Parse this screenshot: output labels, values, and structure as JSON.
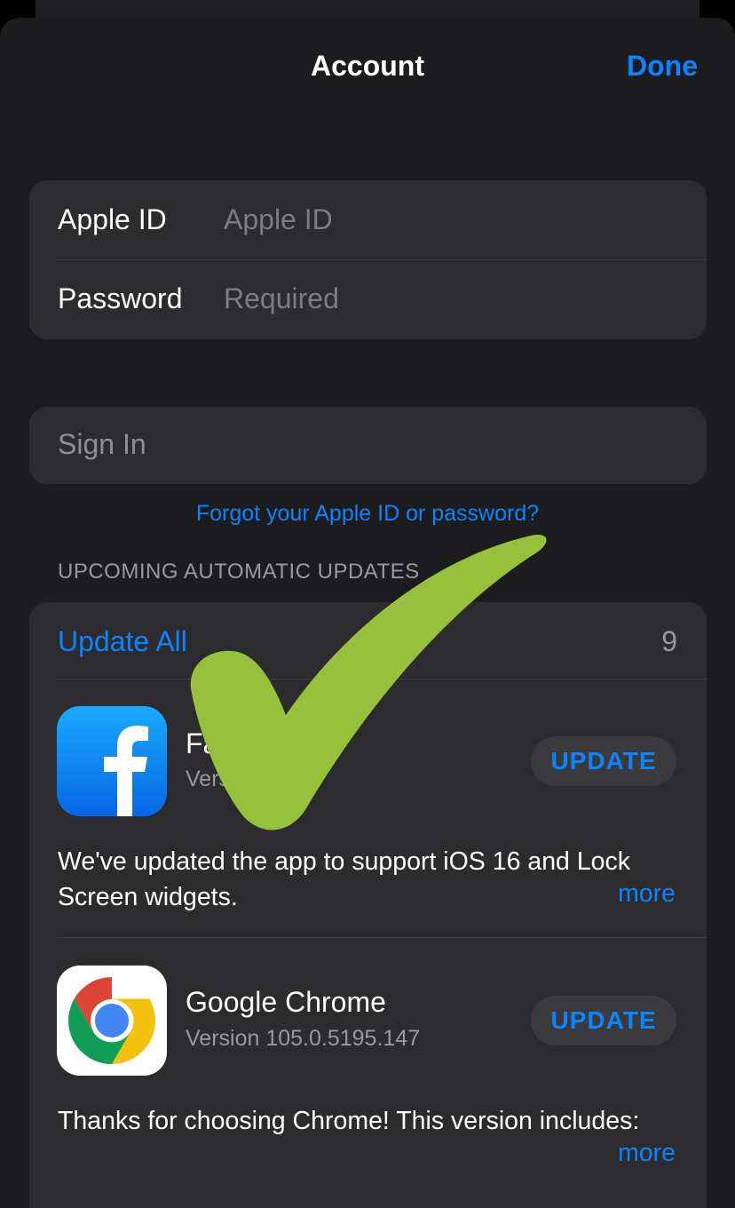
{
  "header": {
    "title": "Account",
    "done_label": "Done"
  },
  "login": {
    "apple_id_label": "Apple ID",
    "apple_id_placeholder": "Apple ID",
    "password_label": "Password",
    "password_placeholder": "Required"
  },
  "sign_in_label": "Sign In",
  "forgot_link": "Forgot your Apple ID or password?",
  "updates": {
    "section_title": "UPCOMING AUTOMATIC UPDATES",
    "update_all_label": "Update All",
    "count": "9",
    "apps": [
      {
        "name": "Fa",
        "version": "Vers",
        "button_label": "UPDATE",
        "notes": "We've updated the app to support iOS 16 and Lock Screen widgets.",
        "more_label": "more",
        "icon": "facebook-icon"
      },
      {
        "name": "Google Chrome",
        "version": "Version 105.0.5195.147",
        "button_label": "UPDATE",
        "notes": "Thanks for choosing Chrome! This version includes:",
        "more_label": "more",
        "icon": "chrome-icon"
      }
    ]
  },
  "colors": {
    "accent": "#0a84ff",
    "background": "#1c1c1e",
    "group": "#2c2c2e",
    "checkmark": "#97c13c"
  }
}
